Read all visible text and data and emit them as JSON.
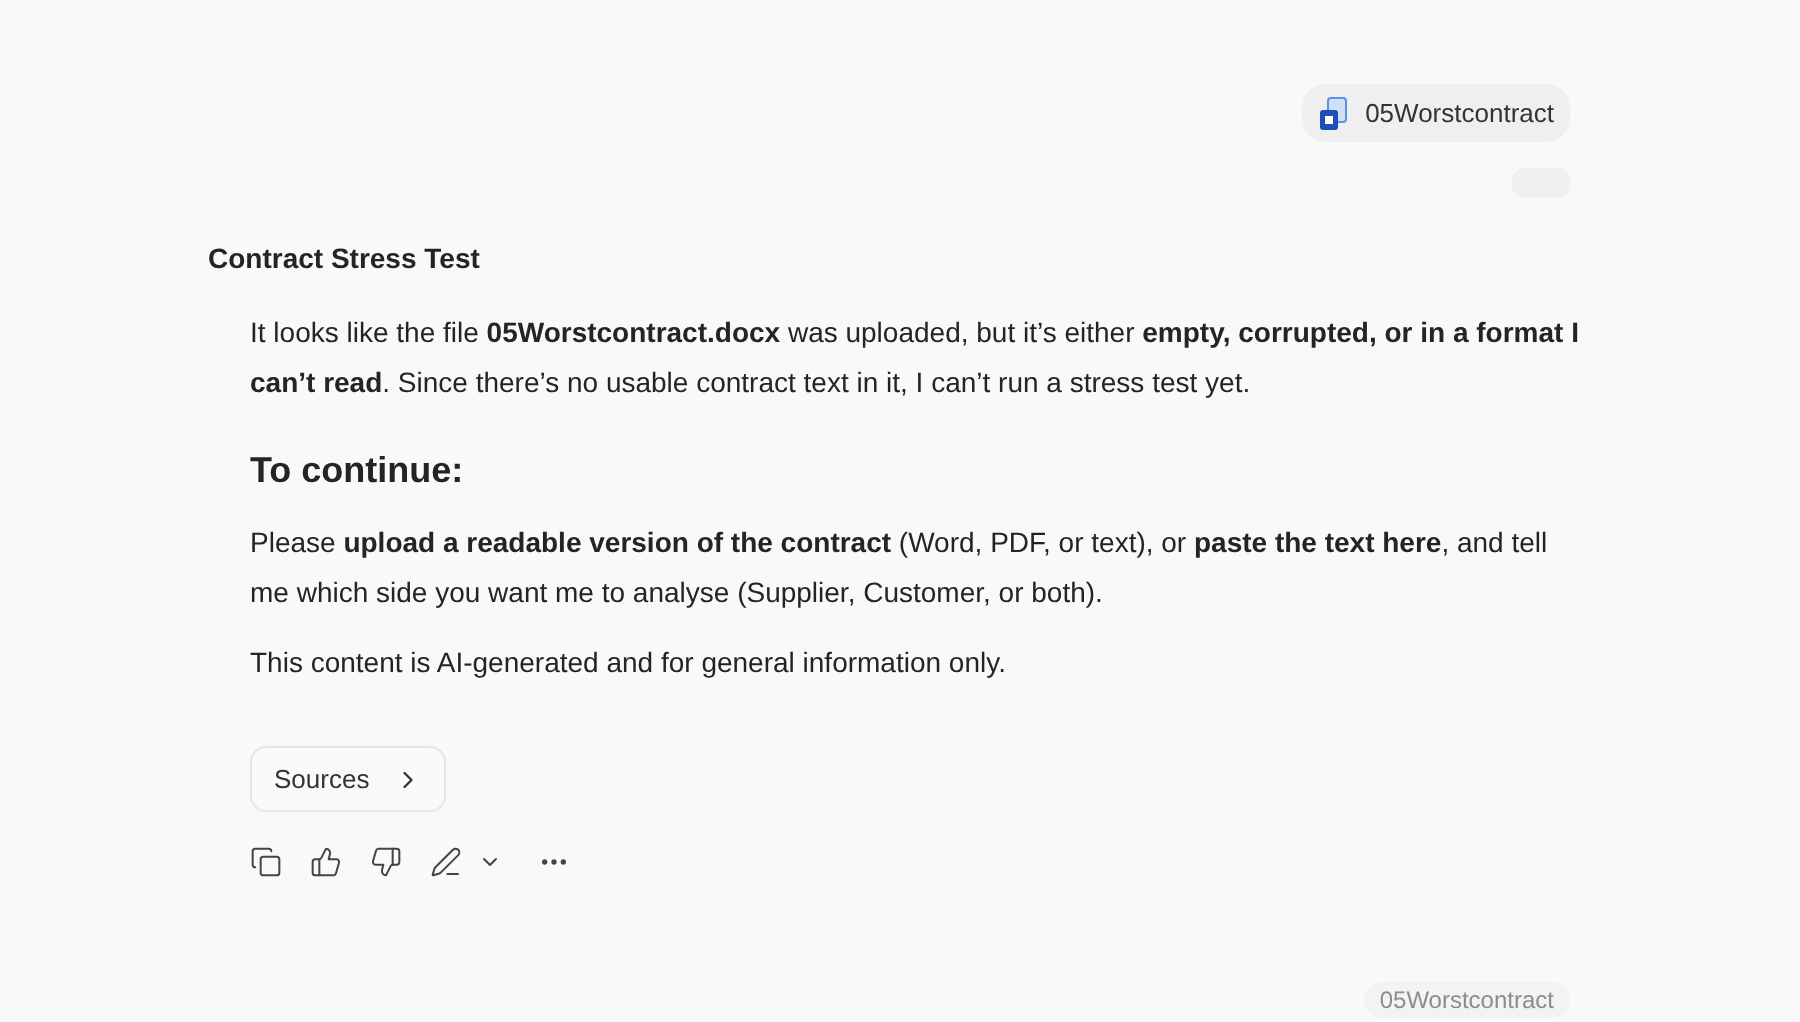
{
  "attachment": {
    "name": "05Worstcontract"
  },
  "response": {
    "title": "Contract Stress Test",
    "paragraphs": [
      {
        "kind": "text",
        "text": "It looks like the file **05Worstcontract.docx** was uploaded, but it’s either **empty, corrupted, or in a format I can’t read**. Since there’s no usable contract text in it, I can’t run a stress test yet."
      },
      {
        "kind": "heading",
        "text": "To continue:"
      },
      {
        "kind": "text",
        "text": "Please **upload a readable version of the contract** (Word, PDF, or text), or **paste the text here**, and tell me which side you want me to analyse (Supplier, Customer, or both)."
      },
      {
        "kind": "text",
        "text": "This content is AI-generated and for general information only."
      }
    ],
    "sources_button": "Sources"
  },
  "ghost_attachment": {
    "name": "05Worstcontract"
  }
}
